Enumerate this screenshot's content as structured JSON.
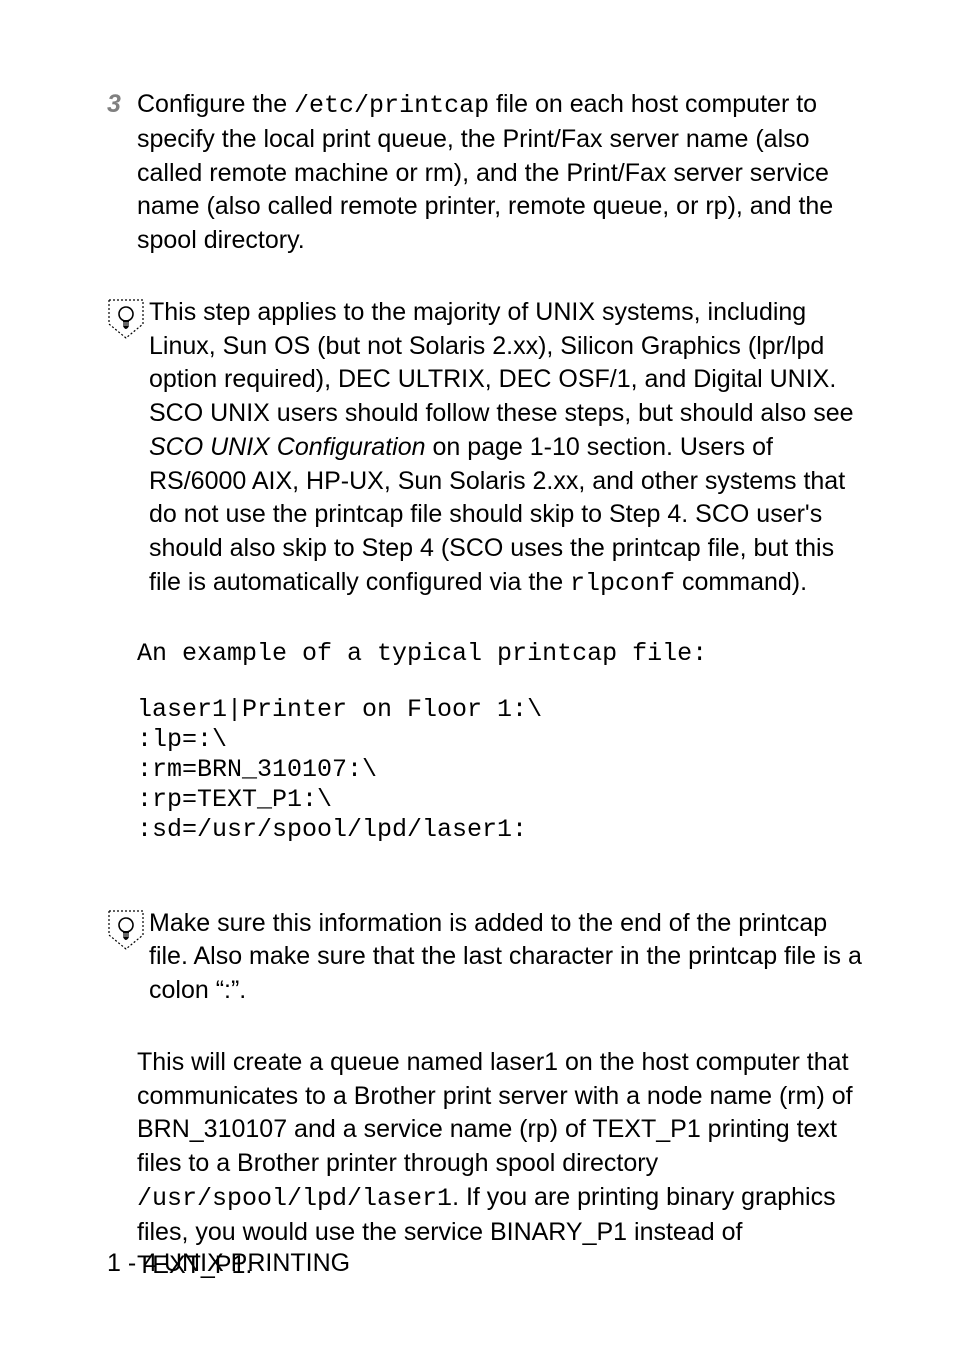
{
  "step": {
    "num": "3",
    "body_parts": [
      {
        "t": "Configure the ",
        "cls": ""
      },
      {
        "t": "/etc/printcap",
        "cls": "mono"
      },
      {
        "t": " file on each host computer to specify the local print queue, the Print/Fax server name (also called remote machine or rm), and the Print/Fax server service name (also called remote printer, remote queue, or rp), and the spool directory.",
        "cls": ""
      }
    ]
  },
  "note1_parts": [
    {
      "t": "This step applies to the majority of UNIX systems, including Linux, Sun OS (but not Solaris 2.xx), Silicon Graphics (lpr/lpd option required), DEC ULTRIX, DEC OSF/1, and Digital UNIX. SCO UNIX users should follow these steps, but should also see ",
      "cls": ""
    },
    {
      "t": "SCO UNIX Configuration",
      "cls": "italic"
    },
    {
      "t": " on page 1-10 section. Users of RS/6000 AIX, HP-UX, Sun Solaris 2.xx, and other systems that do not use the printcap file should skip to Step 4. SCO user's should also skip to Step 4 (SCO uses the printcap file, but this file is automatically configured via the ",
      "cls": ""
    },
    {
      "t": "rlpconf",
      "cls": "mono"
    },
    {
      "t": " command).",
      "cls": ""
    }
  ],
  "code_label": "An example of a typical printcap file:",
  "code_block": "laser1|Printer on Floor 1:\\\n:lp=:\\\n:rm=BRN_310107:\\\n:rp=TEXT_P1:\\\n:sd=/usr/spool/lpd/laser1:",
  "note2": "Make sure this information is added to the end of the printcap file. Also make sure that the last character in the printcap file is a colon “:”.",
  "para_parts": [
    {
      "t": "This will create a queue named laser1 on the host computer that communicates to a Brother print server with a node name (rm) of BRN_310107 and a service name (rp) of TEXT_P1 printing text files to a Brother printer through spool directory ",
      "cls": ""
    },
    {
      "t": "/usr/spool/lpd/laser1",
      "cls": "mono"
    },
    {
      "t": ". If you are printing binary graphics files, you would use the service BINARY_P1 instead of TEXT_P1.",
      "cls": ""
    }
  ],
  "footer": "1 - 4 UNIX PRINTING"
}
